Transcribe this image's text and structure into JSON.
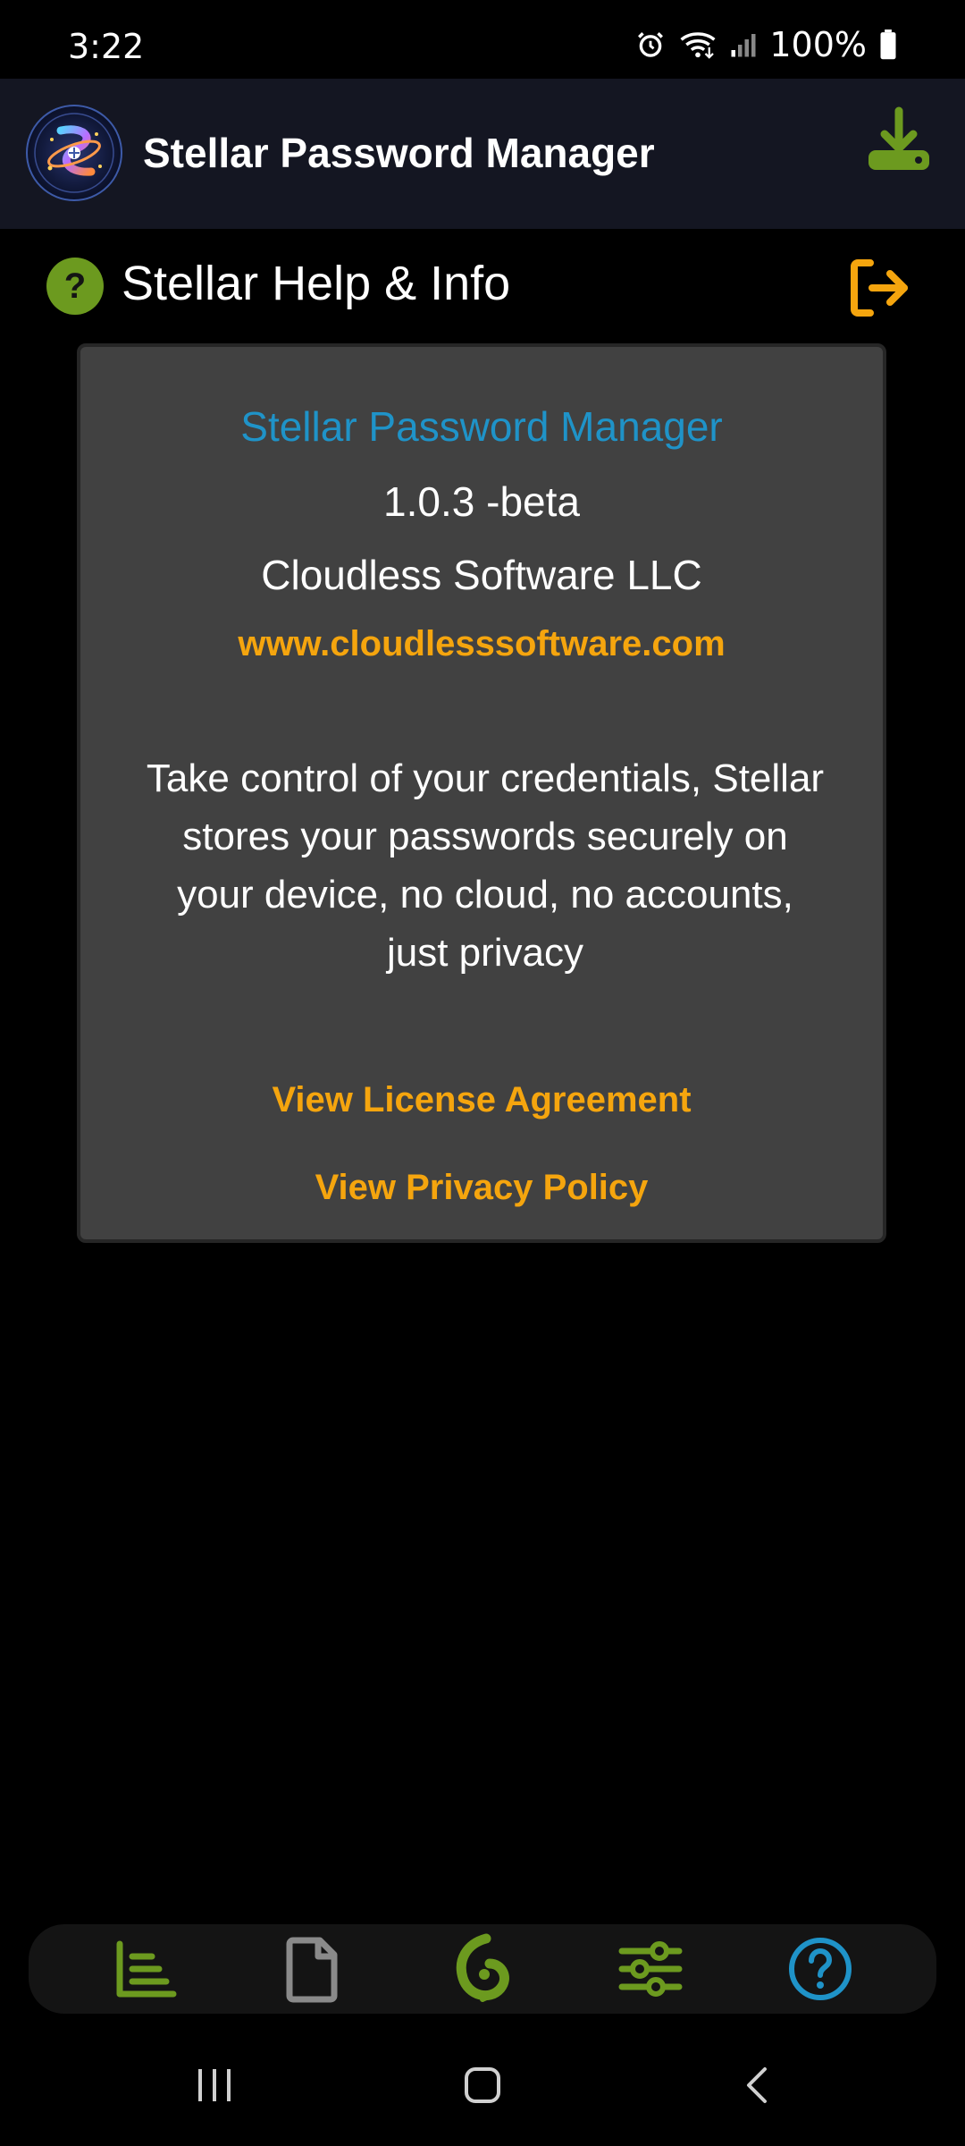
{
  "status_bar": {
    "time": "3:22",
    "battery": "100%",
    "icons": [
      "alarm-icon",
      "wifi-icon",
      "signal-icon",
      "battery-icon"
    ]
  },
  "app_bar": {
    "title": "Stellar Password Manager",
    "logo_icon": "galaxy-logo-icon",
    "download_icon": "download-icon"
  },
  "section": {
    "title": "Stellar Help & Info",
    "badge_glyph": "?",
    "logout_icon": "logout-icon"
  },
  "card": {
    "app_name": "Stellar Password Manager",
    "version": "1.0.3 -beta",
    "company": "Cloudless Software LLC",
    "website": "www.cloudlesssoftware.com",
    "description": "Take control of your credentials, Stellar stores your passwords securely on your device, no cloud, no accounts, just privacy",
    "license_link": "View License Agreement",
    "privacy_link": "View Privacy Policy"
  },
  "bottom_nav": {
    "tabs": [
      {
        "icon": "list-chart-icon",
        "active": false
      },
      {
        "icon": "document-icon",
        "active": false
      },
      {
        "icon": "stellar-swirl-icon",
        "active": false
      },
      {
        "icon": "sliders-icon",
        "active": false
      },
      {
        "icon": "help-circle-icon",
        "active": true
      }
    ]
  },
  "colors": {
    "accent_green": "#6c9a1f",
    "accent_orange": "#f5a50e",
    "accent_blue": "#1f93c8",
    "card_bg": "#414141",
    "app_bar_bg": "#141622"
  }
}
